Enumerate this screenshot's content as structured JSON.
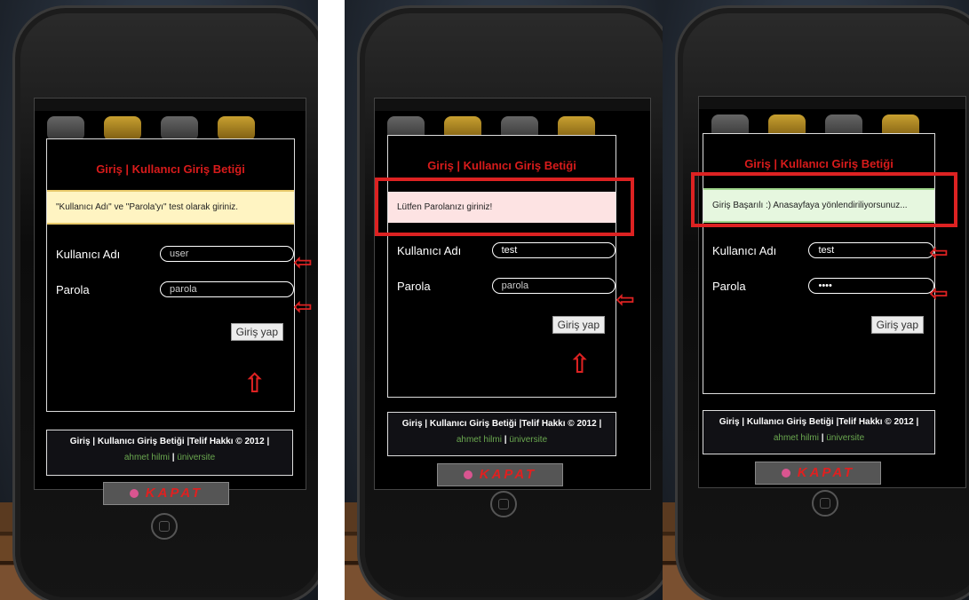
{
  "panels": [
    {
      "title": "Giriş | Kullanıcı Giriş Betiği",
      "notice": "\"Kullanıcı Adı\" ve \"Parola'yı\" test olarak giriniz.",
      "username_label": "Kullanıcı Adı",
      "username_value": "user",
      "password_label": "Parola",
      "password_value": "parola",
      "submit_label": "Giriş yap",
      "footer_text": "Giriş | Kullanıcı Giriş Betiği |Telif Hakkı © 2012 |",
      "footer_link1": "ahmet hilmi",
      "footer_link2": "üniversite",
      "close_label": "KAPAT"
    },
    {
      "title": "Giriş | Kullanıcı Giriş Betiği",
      "notice": "Lütfen Parolanızı giriniz!",
      "username_label": "Kullanıcı Adı",
      "username_value": "test",
      "password_label": "Parola",
      "password_value": "parola",
      "submit_label": "Giriş yap",
      "footer_text": "Giriş | Kullanıcı Giriş Betiği |Telif Hakkı © 2012 |",
      "footer_link1": "ahmet hilmi",
      "footer_link2": "üniversite",
      "close_label": "KAPAT"
    },
    {
      "title": "Giriş | Kullanıcı Giriş Betiği",
      "notice": "Giriş Başarılı :) Anasayfaya yönlendiriliyorsunuz...",
      "username_label": "Kullanıcı Adı",
      "username_value": "test",
      "password_label": "Parola",
      "password_value": "••••",
      "submit_label": "Giriş yap",
      "footer_text": "Giriş | Kullanıcı Giriş Betiği |Telif Hakkı © 2012 |",
      "footer_link1": "ahmet hilmi",
      "footer_link2": "üniversite",
      "close_label": "KAPAT"
    }
  ],
  "colors": {
    "accent_red": "#d81b1b",
    "link_green": "#6aa84f",
    "annotation_red": "#dd2222"
  },
  "icons": {
    "annotation_arrow_left": "arrow-left-icon",
    "annotation_arrow_up": "arrow-up-icon"
  }
}
